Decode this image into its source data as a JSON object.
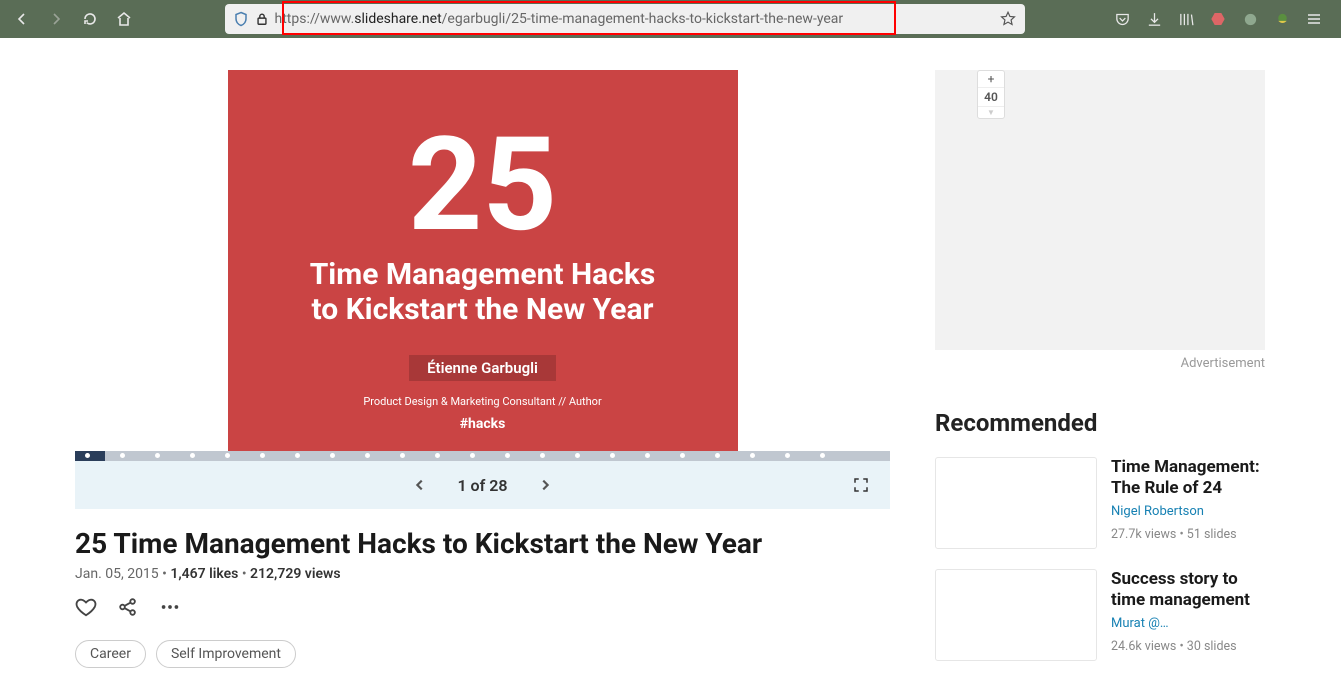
{
  "url": {
    "prefix": "https://www.",
    "domain": "slideshare.net",
    "path": "/egarbugli/25-time-management-hacks-to-kickstart-the-new-year"
  },
  "upvote_count": "40",
  "slide": {
    "big": "25",
    "line1": "Time Management Hacks",
    "line2": "to Kickstart the New Year",
    "author": "Étienne Garbugli",
    "role": "Product Design & Marketing Consultant // Author",
    "hash": "#hacks"
  },
  "pager": {
    "text": "1 of 28"
  },
  "page_title": "25 Time Management Hacks to Kickstart the New Year",
  "meta": {
    "date": "Jan. 05, 2015",
    "likes": "1,467 likes",
    "views": "212,729 views"
  },
  "tags": {
    "t1": "Career",
    "t2": "Self Improvement"
  },
  "ad_label": "Advertisement",
  "rec_heading": "Recommended",
  "recs": {
    "r1": {
      "title": "Time Management: The Rule of 24",
      "author": "Nigel Robertson",
      "stats": "27.7k views • 51 slides"
    },
    "r2": {
      "title": "Success story to time management",
      "author": "Murat @…",
      "stats": "24.6k views • 30 slides"
    }
  }
}
